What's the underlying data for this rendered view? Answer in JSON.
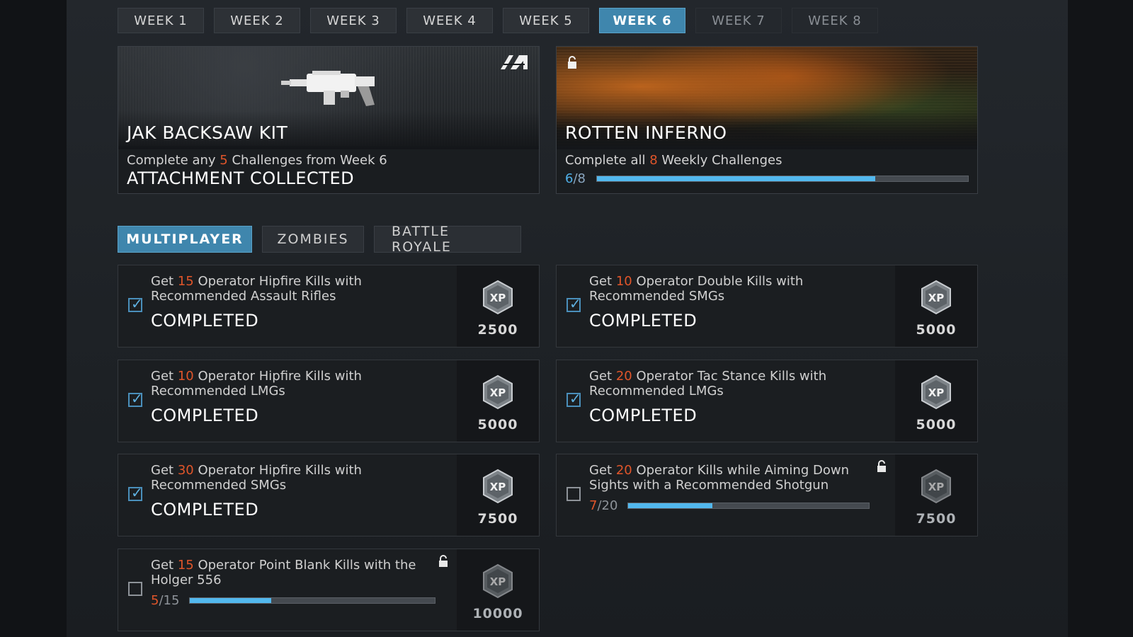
{
  "week_tabs": [
    {
      "label": "WEEK 1",
      "state": "normal"
    },
    {
      "label": "WEEK 2",
      "state": "normal"
    },
    {
      "label": "WEEK 3",
      "state": "normal"
    },
    {
      "label": "WEEK 4",
      "state": "normal"
    },
    {
      "label": "WEEK 5",
      "state": "normal"
    },
    {
      "label": "WEEK 6",
      "state": "active"
    },
    {
      "label": "WEEK 7",
      "state": "locked"
    },
    {
      "label": "WEEK 8",
      "state": "locked"
    }
  ],
  "rewards": {
    "weekly": {
      "title": "JAK BACKSAW KIT",
      "desc_pre": "Complete any ",
      "desc_num": "5",
      "desc_post": " Challenges from Week 6",
      "status": "ATTACHMENT COLLECTED"
    },
    "master": {
      "title": "ROTTEN INFERNO",
      "desc_pre": "Complete all ",
      "desc_num": "8",
      "desc_post": " Weekly Challenges",
      "progress_current": "6",
      "progress_total": "/8",
      "progress_fraction": 0.75
    }
  },
  "mode_tabs": [
    {
      "label": "MULTIPLAYER",
      "active": true
    },
    {
      "label": "ZOMBIES",
      "active": false
    },
    {
      "label": "BATTLE ROYALE",
      "active": false
    }
  ],
  "challenges": [
    {
      "pre": "Get ",
      "num": "15",
      "post": " Operator Hipfire Kills with Recommended Assault Rifles",
      "status": "COMPLETED",
      "xp": "2500",
      "completed": true
    },
    {
      "pre": "Get ",
      "num": "10",
      "post": " Operator Double Kills with Recommended SMGs",
      "status": "COMPLETED",
      "xp": "5000",
      "completed": true
    },
    {
      "pre": "Get ",
      "num": "10",
      "post": " Operator Hipfire Kills with Recommended LMGs",
      "status": "COMPLETED",
      "xp": "5000",
      "completed": true
    },
    {
      "pre": "Get ",
      "num": "20",
      "post": " Operator Tac Stance Kills with Recommended LMGs",
      "status": "COMPLETED",
      "xp": "5000",
      "completed": true
    },
    {
      "pre": "Get ",
      "num": "30",
      "post": " Operator Hipfire Kills with Recommended SMGs",
      "status": "COMPLETED",
      "xp": "7500",
      "completed": true
    },
    {
      "pre": "Get ",
      "num": "20",
      "post": " Operator Kills while Aiming Down Sights with a Recommended Shotgun",
      "xp": "7500",
      "completed": false,
      "progress_current": "7",
      "progress_total": "/20",
      "progress_fraction": 0.35
    },
    {
      "pre": "Get ",
      "num": "15",
      "post": " Operator Point Blank Kills with the Holger 556",
      "xp": "10000",
      "completed": false,
      "progress_current": "5",
      "progress_total": "/15",
      "progress_fraction": 0.333
    }
  ],
  "colors": {
    "accent": "#3f86ad",
    "highlight": "#e0552a",
    "progress": "#52b8ee"
  }
}
